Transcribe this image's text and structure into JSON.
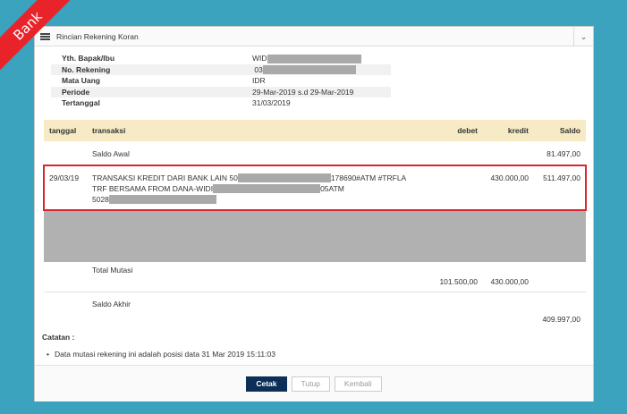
{
  "ribbon": {
    "label": "Bank",
    "color": "#e8232a"
  },
  "panel": {
    "title": "Rincian Rekening Koran",
    "collapse_icon": "chevron-down-icon"
  },
  "info": [
    {
      "label": "Yth. Bapak/Ibu",
      "value": "WID"
    },
    {
      "label": "No. Rekening",
      "value": "03"
    },
    {
      "label": "Mata Uang",
      "value": "IDR"
    },
    {
      "label": "Periode",
      "value": "29-Mar-2019 s.d 29-Mar-2019"
    },
    {
      "label": "Tertanggal",
      "value": "31/03/2019"
    }
  ],
  "table": {
    "headers": {
      "tanggal": "tanggal",
      "transaksi": "transaksi",
      "debet": "debet",
      "kredit": "kredit",
      "saldo": "Saldo"
    },
    "saldo_awal": {
      "label": "Saldo Awal",
      "saldo": "81.497,00"
    },
    "transaction": {
      "date": "29/03/19",
      "line1_a": "TRANSAKSI KREDIT DARI BANK LAIN 50",
      "line1_b": "178690#ATM #TRFLA",
      "line2_a": "TRF BERSAMA FROM DANA-WIDI",
      "line2_b": "05ATM",
      "line3_a": "5028",
      "debet": "",
      "kredit": "430.000,00",
      "saldo": "511.497,00"
    },
    "total_mutasi": {
      "label": "Total Mutasi",
      "debet": "101.500,00",
      "kredit": "430.000,00"
    },
    "saldo_akhir": {
      "label": "Saldo Akhir",
      "saldo": "409.997,00"
    }
  },
  "catatan": {
    "title": "Catatan :",
    "items": [
      "Data mutasi rekening ini adalah posisi data 31 Mar 2019 15:11:03"
    ]
  },
  "buttons": {
    "cetak": "Cetak",
    "tutup": "Tutup",
    "kembali": "Kembali"
  },
  "colors": {
    "background": "#3ba3bd",
    "header_row": "#f6ebc4",
    "highlight": "#d9252d",
    "primary_button": "#0d2f57"
  }
}
